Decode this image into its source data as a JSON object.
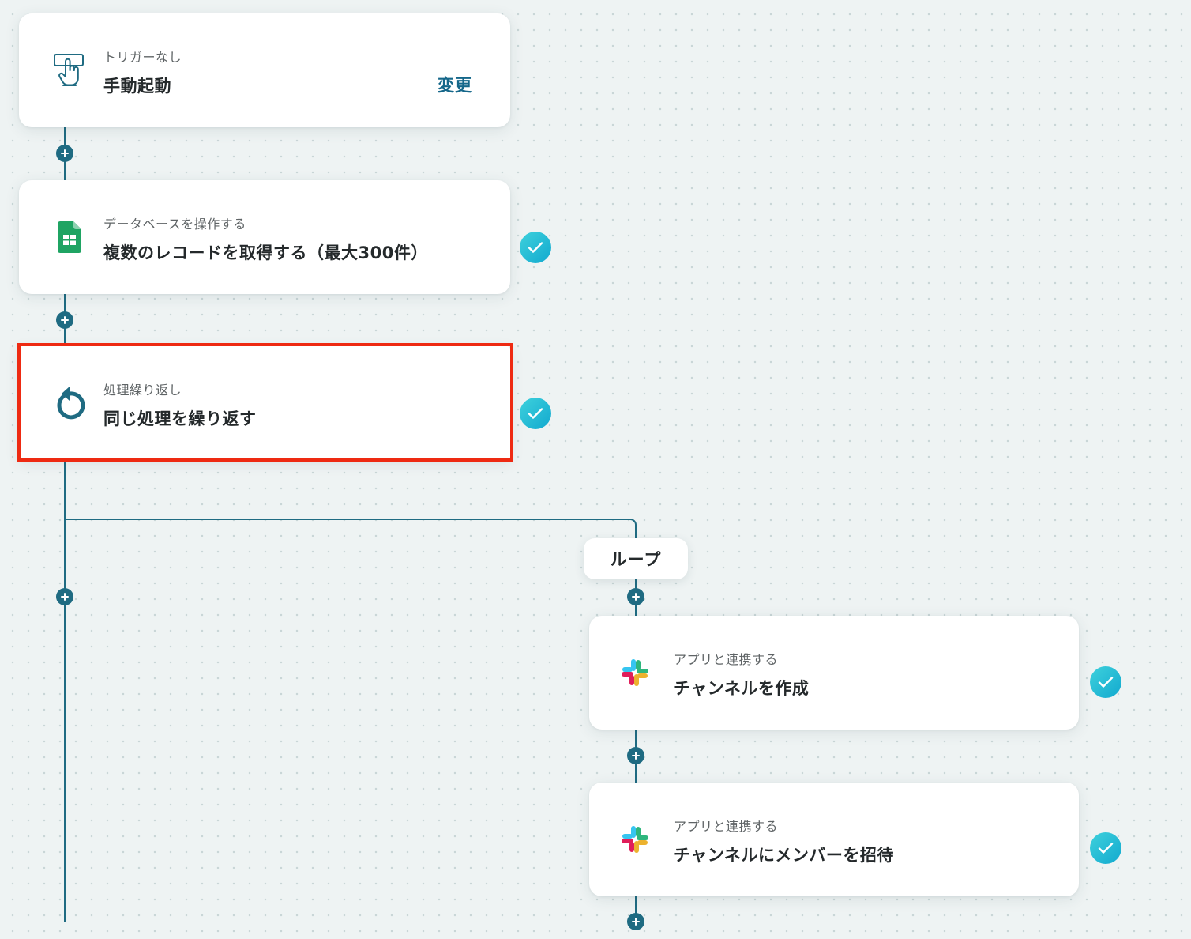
{
  "colors": {
    "accent": "#1f6b82",
    "link": "#15678a",
    "check": "#1bb8d4",
    "selection": "#ee2a12"
  },
  "steps": [
    {
      "category": "トリガーなし",
      "title": "手動起動",
      "icon": "hand-tap-icon",
      "action": "変更"
    },
    {
      "category": "データベースを操作する",
      "title": "複数のレコードを取得する（最大300件）",
      "icon": "google-sheets-icon"
    },
    {
      "category": "処理繰り返し",
      "title": "同じ処理を繰り返す",
      "icon": "loop-repeat-icon"
    }
  ],
  "loop": {
    "label": "ループ",
    "steps": [
      {
        "category": "アプリと連携する",
        "title": "チャンネルを作成",
        "icon": "slack-icon"
      },
      {
        "category": "アプリと連携する",
        "title": "チャンネルにメンバーを招待",
        "icon": "slack-icon"
      }
    ]
  }
}
